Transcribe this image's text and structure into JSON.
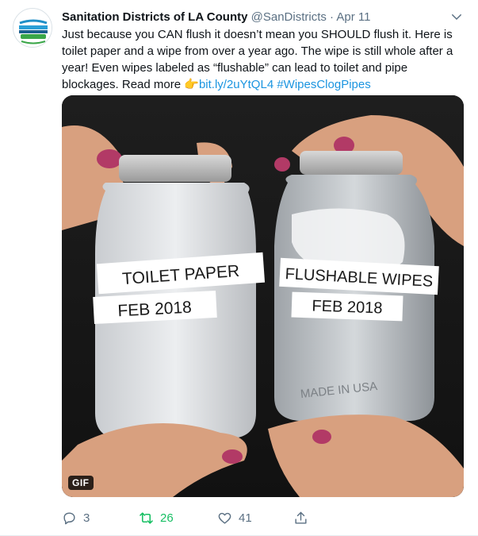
{
  "tweet": {
    "author_name": "Sanitation Districts of LA County",
    "author_handle": "@SanDistricts",
    "separator": "·",
    "date": "Apr 11",
    "text_1": "Just because you CAN flush it doesn’t mean you SHOULD flush it. Here is toilet paper and a wipe from over a year ago. The wipe is still whole after a year! Even wipes labeled as “flushable” can lead to toilet and pipe blockages. Read more ",
    "emoji": "👉",
    "link": "bit.ly/2uYtQL4",
    "hashtag": "#WipesClogPipes"
  },
  "media": {
    "badge": "GIF",
    "jar_left_label_1": "TOILET PAPER",
    "jar_left_label_2": "FEB 2018",
    "jar_right_label_1": "FLUSHABLE WIPES",
    "jar_right_label_2": "FEB 2018",
    "jar_embossing": "MADE IN USA"
  },
  "actions": {
    "reply_count": "3",
    "retweet_count": "26",
    "like_count": "41"
  },
  "colors": {
    "link": "#1b95e0",
    "retweet_active": "#17bf63",
    "muted": "#5b7083"
  },
  "icons": [
    "avatar-logo",
    "chevron-down-icon",
    "reply-icon",
    "retweet-icon",
    "like-icon",
    "share-icon"
  ]
}
